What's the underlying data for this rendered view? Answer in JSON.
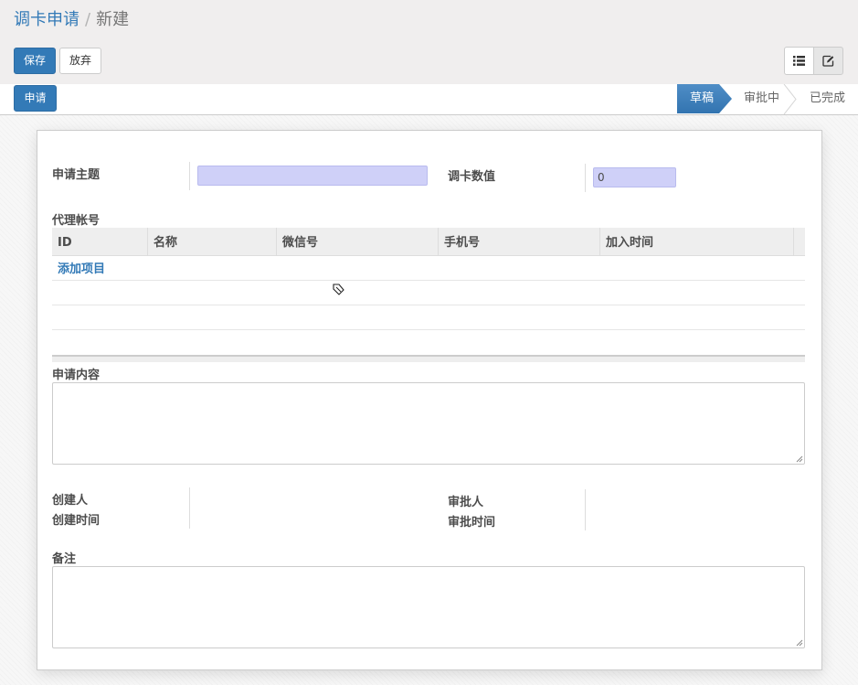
{
  "breadcrumb": {
    "parent": "调卡申请",
    "separator": "/",
    "current": "新建"
  },
  "toolbar": {
    "save_label": "保存",
    "discard_label": "放弃"
  },
  "view_switcher": {
    "items": [
      {
        "icon": "list-icon"
      },
      {
        "icon": "edit-icon",
        "active": true
      }
    ]
  },
  "statusbar": {
    "action_label": "申请",
    "stages": [
      {
        "label": "草稿",
        "active": true
      },
      {
        "label": "审批中",
        "active": false
      },
      {
        "label": "已完成",
        "active": false
      }
    ]
  },
  "form": {
    "subject_label": "申请主题",
    "subject_value": "",
    "amount_label": "调卡数值",
    "amount_value": "0",
    "agent_section_label": "代理帐号",
    "table": {
      "columns": [
        "ID",
        "名称",
        "微信号",
        "手机号",
        "加入时间"
      ],
      "add_label": "添加项目"
    },
    "content_label": "申请内容",
    "creator_label": "创建人",
    "created_time_label": "创建时间",
    "approver_label": "审批人",
    "approval_time_label": "审批时间",
    "note_label": "备注"
  },
  "colors": {
    "primary": "#337ab7",
    "required_field_bg": "#cfd0f8",
    "active_stage": "#3a7bb8"
  }
}
